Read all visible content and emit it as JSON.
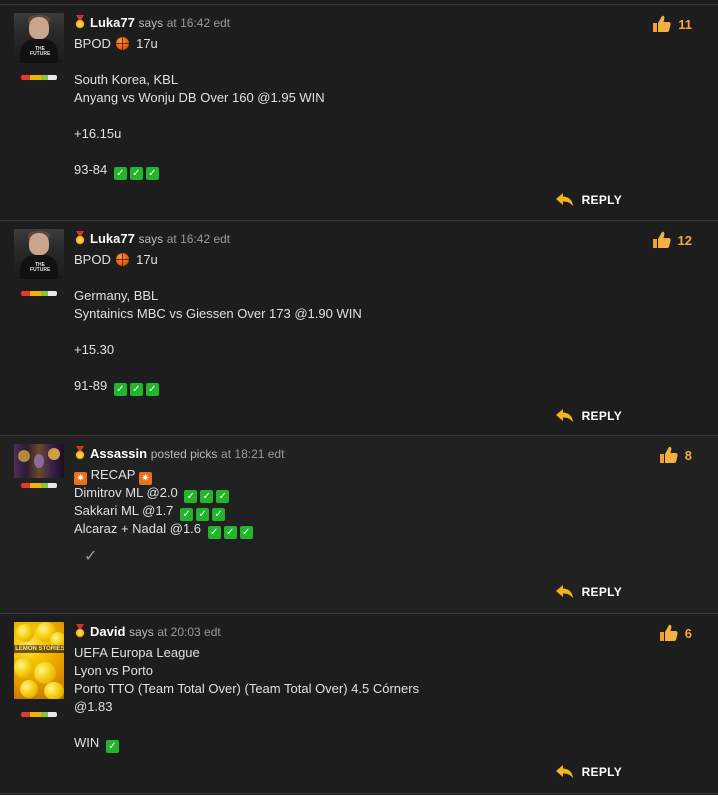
{
  "posts": [
    {
      "user": "Luka77",
      "action": "says",
      "time": "at 16:42 edt",
      "likes": "11",
      "lines": [
        "BPOD",
        "17u",
        "South Korea, KBL",
        "Anyang vs Wonju DB Over 160 @1.95 WIN",
        "+16.15u",
        "93-84"
      ],
      "reply": "REPLY"
    },
    {
      "user": "Luka77",
      "action": "says",
      "time": "at 16:42 edt",
      "likes": "12",
      "lines": [
        "BPOD",
        "17u",
        "Germany, BBL",
        "Syntainics MBC vs Giessen Over 173 @1.90 WIN",
        "+15.30",
        "91-89"
      ],
      "reply": "REPLY"
    },
    {
      "user": "Assassin",
      "action": "posted picks",
      "time": "at 18:21 edt",
      "likes": "8",
      "lines": [
        "RECAP",
        "Dimitrov ML @2.0",
        "Sakkari ML @1.7",
        "Alcaraz + Nadal @1.6"
      ],
      "reply": "REPLY"
    },
    {
      "user": "David",
      "action": "says",
      "time": "at 20:03 edt",
      "likes": "6",
      "lines": [
        "UEFA Europa League",
        "Lyon vs Porto",
        "Porto TTO (Team Total Over) (Team Total Over) 4.5 Córners",
        "@1.83",
        "WIN"
      ],
      "reply": "REPLY"
    }
  ],
  "avatars": {
    "luka_shirt_text": "THE FUTURE",
    "david_text": "LEMON STORIES"
  },
  "icons": {
    "check": "✓",
    "star": "✷"
  },
  "colors": {
    "like_count": "#f4a73a",
    "check": "#22b42b",
    "reply_arrow": "#f5b31c"
  }
}
